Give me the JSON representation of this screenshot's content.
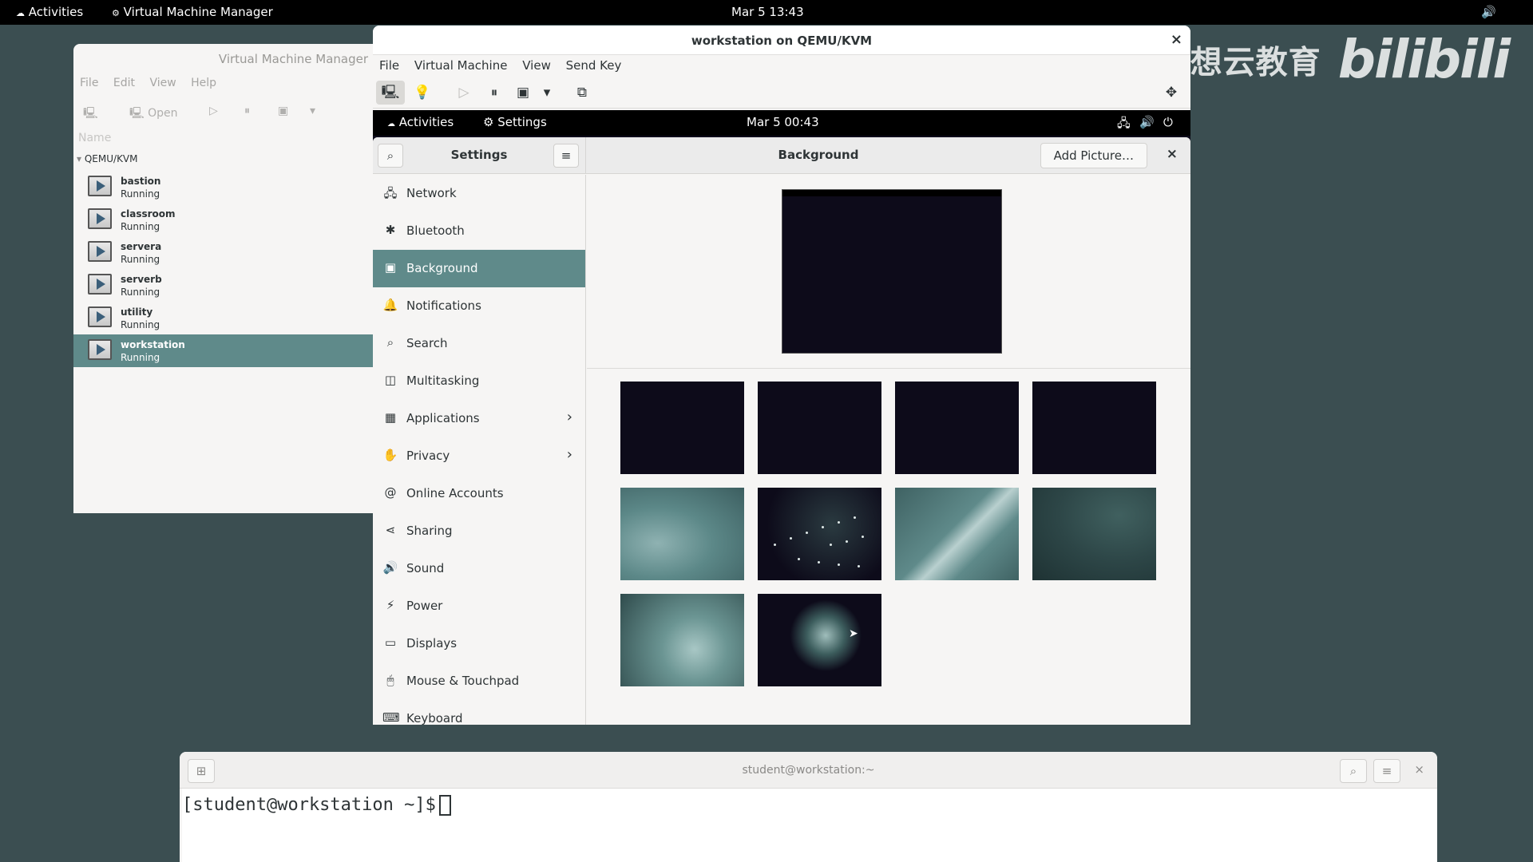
{
  "host_topbar": {
    "activities": "Activities",
    "app_name": "Virtual Machine Manager",
    "datetime": "Mar 5  13:43",
    "volume_icon": "speaker-icon"
  },
  "watermark": {
    "text": "杭州创想云教育",
    "logo": "bilibili"
  },
  "vmm": {
    "title": "Virtual Machine Manager",
    "menu": [
      "File",
      "Edit",
      "View",
      "Help"
    ],
    "toolbar": {
      "open_label": "Open"
    },
    "column_header": "Name",
    "connection": "QEMU/KVM",
    "vms": [
      {
        "name": "bastion",
        "status": "Running"
      },
      {
        "name": "classroom",
        "status": "Running"
      },
      {
        "name": "servera",
        "status": "Running"
      },
      {
        "name": "serverb",
        "status": "Running"
      },
      {
        "name": "utility",
        "status": "Running"
      },
      {
        "name": "workstation",
        "status": "Running",
        "selected": true
      }
    ]
  },
  "kvm": {
    "title": "workstation on QEMU/KVM",
    "menu": [
      "File",
      "Virtual Machine",
      "View",
      "Send Key"
    ]
  },
  "guest_topbar": {
    "activities": "Activities",
    "app": "Settings",
    "datetime": "Mar 5  00:43"
  },
  "settings": {
    "title": "Settings",
    "panel_title": "Background",
    "add_picture": "Add Picture…",
    "sidebar": [
      {
        "icon": "network-icon",
        "glyph": "🖧",
        "label": "Network"
      },
      {
        "icon": "bluetooth-icon",
        "glyph": "✱",
        "label": "Bluetooth"
      },
      {
        "icon": "background-icon",
        "glyph": "▣",
        "label": "Background",
        "selected": true
      },
      {
        "icon": "bell-icon",
        "glyph": "🔔",
        "label": "Notifications"
      },
      {
        "icon": "search-icon",
        "glyph": "⌕",
        "label": "Search"
      },
      {
        "icon": "multitasking-icon",
        "glyph": "◫",
        "label": "Multitasking"
      },
      {
        "icon": "grid-icon",
        "glyph": "▦",
        "label": "Applications",
        "chevron": true
      },
      {
        "icon": "hand-icon",
        "glyph": "✋",
        "label": "Privacy",
        "chevron": true
      },
      {
        "icon": "at-icon",
        "glyph": "@",
        "label": "Online Accounts"
      },
      {
        "icon": "share-icon",
        "glyph": "⋖",
        "label": "Sharing"
      },
      {
        "icon": "speaker-icon",
        "glyph": "🔊",
        "label": "Sound"
      },
      {
        "icon": "power-icon",
        "glyph": "⚡",
        "label": "Power"
      },
      {
        "icon": "display-icon",
        "glyph": "▭",
        "label": "Displays"
      },
      {
        "icon": "mouse-icon",
        "glyph": "🖱",
        "label": "Mouse & Touchpad"
      },
      {
        "icon": "keyboard-icon",
        "glyph": "⌨",
        "label": "Keyboard"
      }
    ]
  },
  "terminal": {
    "title": "student@workstation:~",
    "prompt": "[student@workstation ~]$"
  },
  "colors": {
    "accent": "#5f8a8a",
    "desktop": "#3b4e51",
    "guest_bg": "#0d0b1a"
  }
}
